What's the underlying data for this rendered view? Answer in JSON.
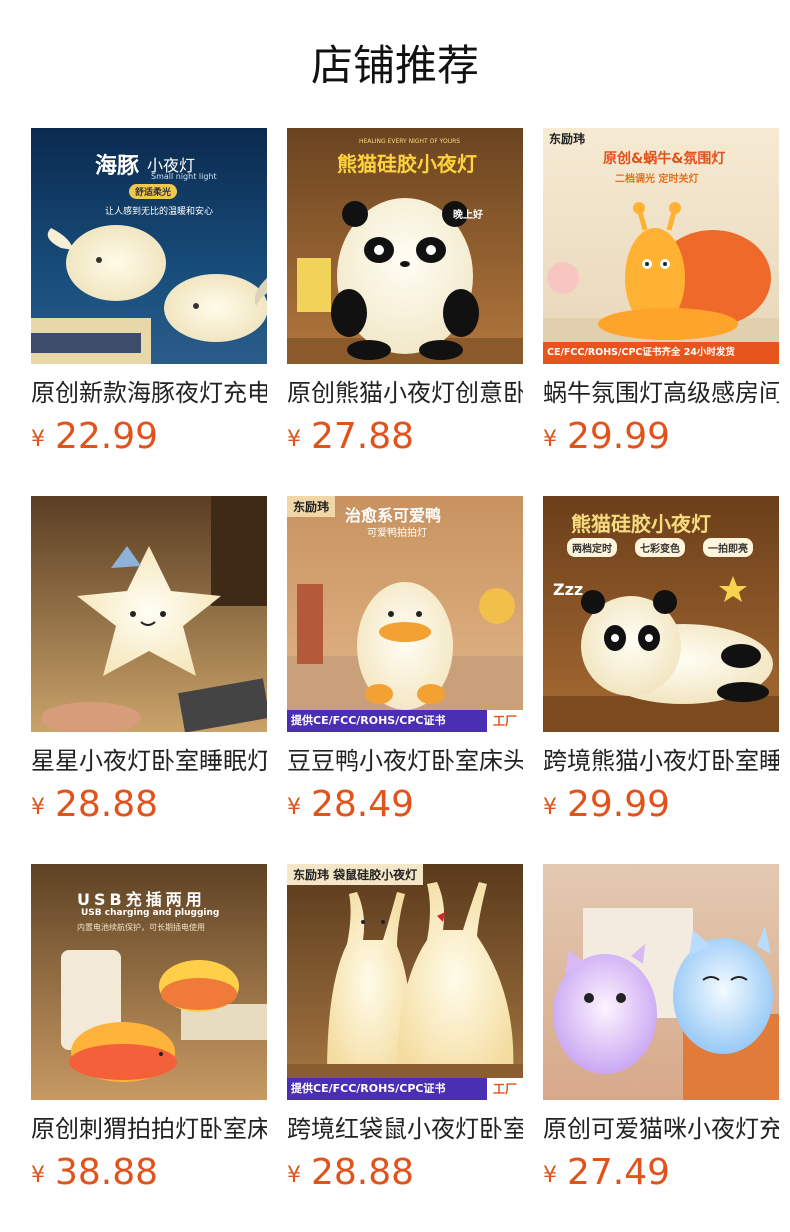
{
  "page": {
    "title": "店铺推荐",
    "currency_symbol": "¥"
  },
  "products": [
    {
      "name": "原创新款海豚夜灯充电卧室",
      "price": "22.99",
      "image_text": {
        "headline": "海豚",
        "headline2": "小夜灯",
        "sub": "Small night light",
        "pill": "舒适柔光",
        "line": "让人感到无比的温暖和安心"
      }
    },
    {
      "name": "原创熊猫小夜灯创意卧室",
      "price": "27.88",
      "image_text": {
        "top": "HEALING EVERY NIGHT OF YOURS",
        "headline": "熊猫硅胶小夜灯",
        "note": "晚上好"
      }
    },
    {
      "name": "蜗牛氛围灯高级感房间",
      "price": "29.99",
      "image_text": {
        "tag": "东励玮",
        "headline": "原创&蜗牛&氛围灯",
        "sub": "二档调光 定时关灯",
        "badge": "CE/FCC/ROHS/CPC证书齐全 24小时发货"
      }
    },
    {
      "name": "星星小夜灯卧室睡眠灯",
      "price": "28.88",
      "image_text": {}
    },
    {
      "name": "豆豆鸭小夜灯卧室床头",
      "price": "28.49",
      "image_text": {
        "tag": "东励玮",
        "headline": "治愈系可爱鸭",
        "sub": "可爱鸭拍拍灯",
        "badge": "提供CE/FCC/ROHS/CPC证书",
        "badge_right": "工厂"
      }
    },
    {
      "name": "跨境熊猫小夜灯卧室睡眠",
      "price": "29.99",
      "image_text": {
        "headline": "熊猫硅胶小夜灯",
        "chips": [
          "两档定时",
          "七彩变色",
          "一拍即亮"
        ],
        "zzz": "Zzz"
      }
    },
    {
      "name": "原创刺猬拍拍灯卧室床头",
      "price": "38.88",
      "image_text": {
        "headline": "USB充插两用",
        "sub": "USB charging and plugging",
        "line": "内置电池续航保护，可长期插电使用"
      }
    },
    {
      "name": "跨境红袋鼠小夜灯卧室",
      "price": "28.88",
      "image_text": {
        "tag": "东励玮  袋鼠硅胶小夜灯",
        "badge": "提供CE/FCC/ROHS/CPC证书",
        "badge_right": "工厂"
      }
    },
    {
      "name": "原创可爱猫咪小夜灯充电",
      "price": "27.49",
      "image_text": {}
    }
  ],
  "colors": {
    "price": "#e0531b",
    "title": "#111111",
    "badge_purple": "#4b2fb3",
    "badge_orange": "#e8551c"
  }
}
